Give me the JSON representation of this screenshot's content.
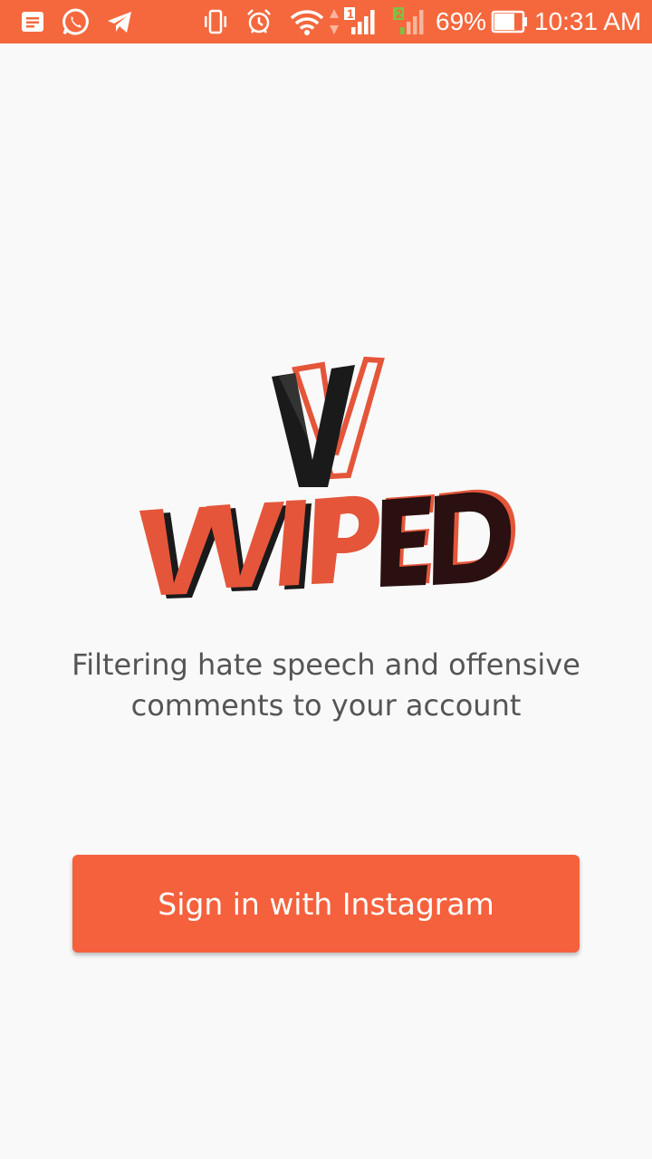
{
  "status_bar": {
    "battery": "69%",
    "time": "10:31 AM",
    "sim1_label": "1",
    "sim2_label": "2",
    "icons": [
      "notes-icon",
      "whatsapp-icon",
      "telegram-icon",
      "vibrate-icon",
      "alarm-icon",
      "wifi-icon",
      "data-arrows-icon",
      "signal-sim1-icon",
      "signal-sim2-icon",
      "battery-icon"
    ],
    "colors": {
      "background": "#f5683d",
      "sim2_accent": "#7cc242"
    }
  },
  "logo": {
    "text": "VVIPED",
    "colors": {
      "orange": "#e5553a",
      "dark": "#2a1010",
      "black": "#1a1a1a"
    }
  },
  "tagline": {
    "line1": "Filtering hate speech and offensive",
    "line2": "comments to your account"
  },
  "signin_button": {
    "label": "Sign in with Instagram",
    "color": "#f5613d"
  }
}
